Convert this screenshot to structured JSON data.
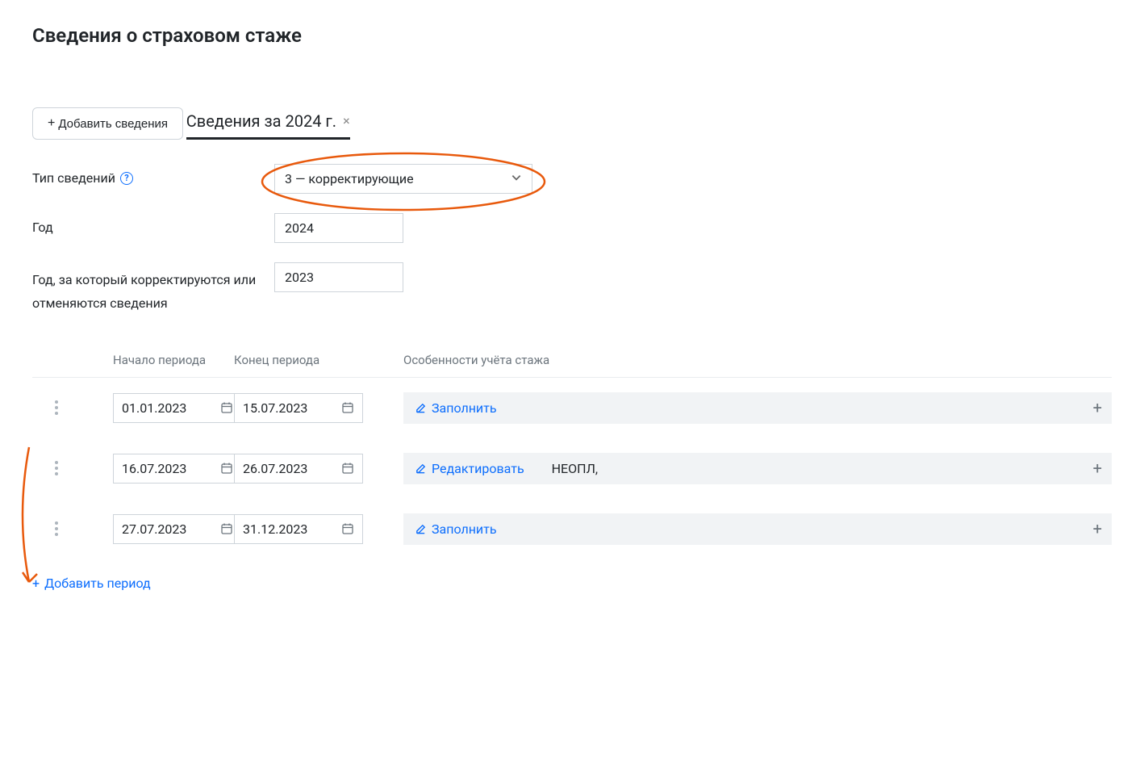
{
  "header": {
    "title": "Сведения о страховом стаже"
  },
  "buttons": {
    "add_info": "Добавить сведения",
    "add_period": "Добавить период"
  },
  "tab": {
    "label": "Сведения за 2024 г.",
    "close": "×"
  },
  "form": {
    "type_label": "Тип сведений",
    "type_value": "3 — корректирующие",
    "year_label": "Год",
    "year_value": "2024",
    "corr_year_label": "Год, за который корректируются или отменяются сведения",
    "corr_year_value": "2023"
  },
  "periods": {
    "col_start": "Начало периода",
    "col_end": "Конец периода",
    "col_feat": "Особенности учёта стажа",
    "fill_label": "Заполнить",
    "edit_label": "Редактировать",
    "rows": [
      {
        "start": "01.01.2023",
        "end": "15.07.2023",
        "action": "fill",
        "extra": ""
      },
      {
        "start": "16.07.2023",
        "end": "26.07.2023",
        "action": "edit",
        "extra": "НЕОПЛ,"
      },
      {
        "start": "27.07.2023",
        "end": "31.12.2023",
        "action": "fill",
        "extra": ""
      }
    ]
  }
}
